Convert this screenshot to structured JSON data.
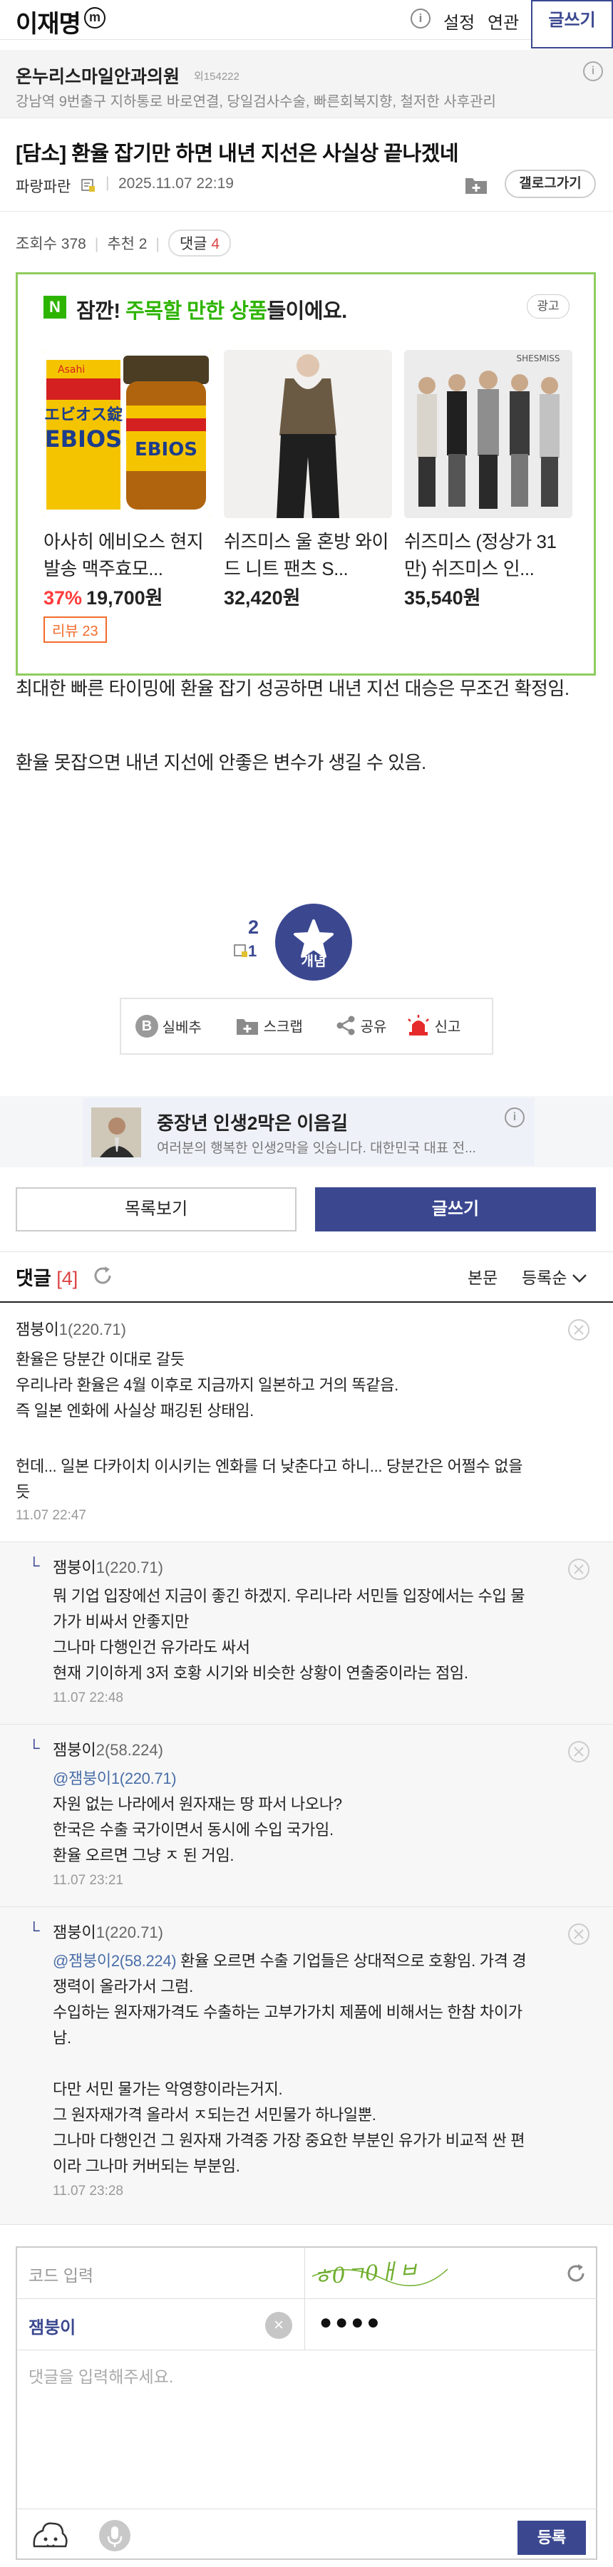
{
  "header": {
    "gallery_title": "이재명",
    "minor_badge": "m",
    "settings": "설정",
    "related": "연관",
    "write": "글쓰기"
  },
  "ad_banner_1": {
    "title": "온누리스마일안과의원",
    "code": "외154222",
    "description": "강남역 9번출구 지하통로 바로연결, 당일검사수술, 빠른회복지향, 철저한 사후관리"
  },
  "post": {
    "title": "[담소] 환율 잡기만 하면 내년 지선은 사실상 끝나겠네",
    "author": "파랑파란",
    "date": "2025.11.07 22:19",
    "gallery_button": "갤로그가기",
    "views_label": "조회수 378",
    "recommend_label": "추천 2",
    "comment_label": "댓글",
    "comment_count": "4",
    "body": [
      "최대한 빠른 타이밍에 환율 잡기 성공하면 내년 지선 대승은 무조건 확정임.",
      "환율 못잡으면 내년 지선에 안좋은 변수가 생길 수 있음."
    ]
  },
  "product_ad": {
    "badge": "N",
    "headline_prefix": "잠깐! ",
    "headline_highlight": "주목할 만한 상품",
    "headline_suffix": "들이에요.",
    "ad_tag": "광고",
    "items": [
      {
        "name": "아사히 에비오스 현지발송 맥주효모...",
        "discount": "37%",
        "price": "19,700원",
        "review": "리뷰 23"
      },
      {
        "name": "쉬즈미스 울 혼방 와이드 니트 팬츠 S...",
        "discount": "",
        "price": "32,420원",
        "review": ""
      },
      {
        "name": "쉬즈미스 (정상가 31만) 쉬즈미스 인...",
        "discount": "",
        "price": "35,540원",
        "review": ""
      }
    ],
    "image_texts": [
      "エビオス錠",
      "EBIOS",
      "Asahi",
      "SHESMISS"
    ]
  },
  "recommend": {
    "count": "2",
    "fixed_count": "1",
    "label": "개념"
  },
  "share_bar": {
    "items": [
      "실베추",
      "스크랩",
      "공유",
      "신고"
    ]
  },
  "ad_banner_2": {
    "title": "중장년 인생2막은 이음길",
    "description": "여러분의 행복한 인생2막을 잇습니다. 대한민국 대표 전..."
  },
  "buttons": {
    "list": "목록보기",
    "write": "글쓰기"
  },
  "comments_header": {
    "label": "댓글",
    "count": "[4]",
    "body_link": "본문",
    "sort": "등록순"
  },
  "comments": [
    {
      "nick": "잼붕이",
      "ip": "1(220.71)",
      "lines": [
        "환율은 당분간 이대로 갈듯",
        "우리나라 환율은 4월 이후로 지금까지 일본하고 거의 똑같음.",
        "즉 일본 엔화에 사실상 패깅된 상태임.",
        "",
        "헌데... 일본 다카이치 이시키는 엔화를 더 낮춘다고 하니... 당분간은 어쩔수 없을",
        "듯"
      ],
      "time": "11.07 22:47"
    },
    {
      "nick": "잼붕이",
      "ip": "1(220.71)",
      "mention": "",
      "lines": [
        "뭐 기업 입장에선 지금이 좋긴 하겠지. 우리나라 서민들 입장에서는 수입 물",
        "가가 비싸서 안좋지만",
        "그나마 다행인건 유가라도 싸서",
        "현재 기이하게 3저 호황 시기와 비슷한 상황이 연출중이라는 점임."
      ],
      "time": "11.07 22:48"
    },
    {
      "nick": "잼붕이",
      "ip": "2(58.224)",
      "mention": "@잼붕이1(220.71)",
      "lines": [
        "자원 없는 나라에서 원자재는 땅 파서 나오나?",
        "한국은 수출 국가이면서 동시에 수입 국가임.",
        "환율 오르면 그냥 ㅈ 된 거임."
      ],
      "time": "11.07 23:21"
    },
    {
      "nick": "잼붕이",
      "ip": "1(220.71)",
      "mention": "@잼붕이2(58.224)",
      "first_line_rest": " 환율 오르면 수출 기업들은 상대적으로 호황임. 가격 경",
      "lines": [
        "쟁력이 올라가서 그럼.",
        "수입하는 원자재가격도 수출하는 고부가가치 제품에 비해서는 한참 차이가",
        "남.",
        "",
        "다만 서민 물가는 악영향이라는거지.",
        "그 원자재가격 올라서 ㅈ되는건 서민물가 하나일뿐.",
        "그나마 다행인건 그 원자재 가격중 가장 중요한 부분인 유가가 비교적 싼 편",
        "이라 그나마 커버되는 부분임."
      ],
      "time": "11.07 23:28"
    }
  ],
  "comment_form": {
    "code_placeholder": "코드 입력",
    "captcha_text": "ㅎ0ㄱ0ㅐㅂ",
    "nick": "잼붕이",
    "password": "●●●●",
    "textarea_placeholder": "댓글을 입력해주세요.",
    "submit": "등록"
  },
  "colors": {
    "brand": "#3b4890",
    "accent_red": "#d44444",
    "ad_green": "#2db400",
    "discount": "#ff3b3b"
  }
}
